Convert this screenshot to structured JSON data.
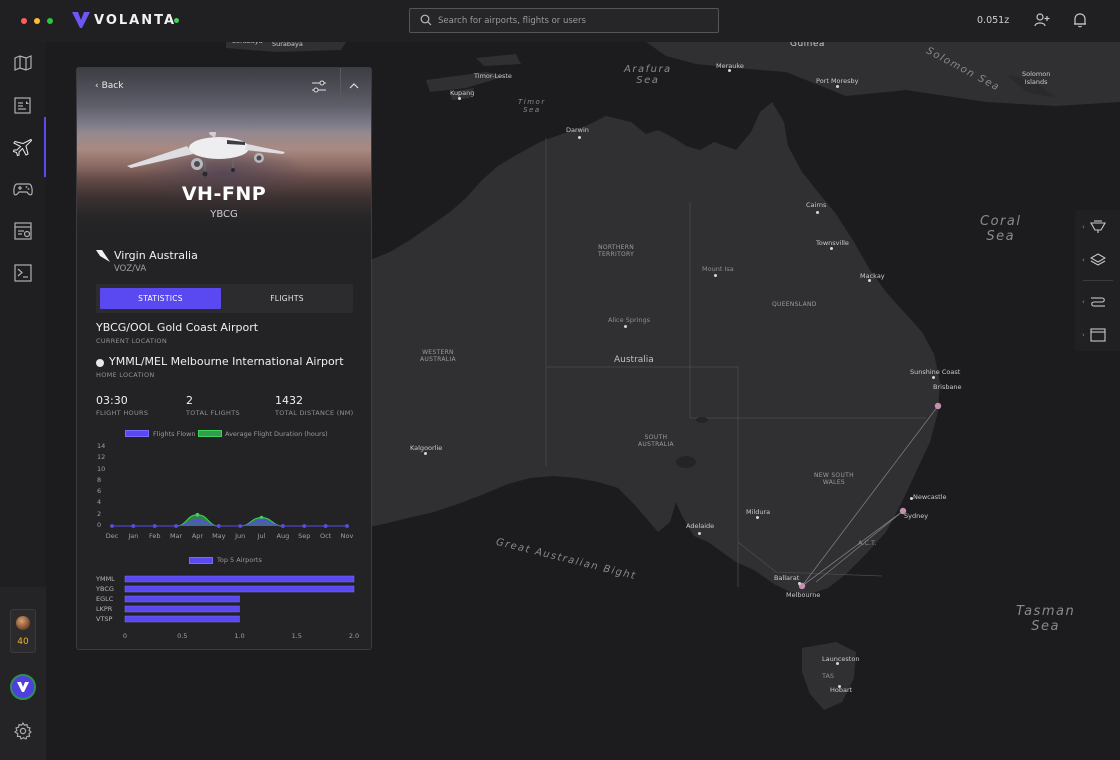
{
  "app": {
    "name": "VOLANTA",
    "zulu_time": "0.051z"
  },
  "search": {
    "placeholder": "Search for airports, flights or users"
  },
  "sidebar": {
    "items": [
      {
        "name": "map-icon"
      },
      {
        "name": "flight-plan-icon"
      },
      {
        "name": "aircraft-icon"
      },
      {
        "name": "gamepad-icon"
      },
      {
        "name": "logbook-icon"
      },
      {
        "name": "terminal-icon"
      }
    ],
    "user": {
      "points": "40"
    }
  },
  "map": {
    "regions": [
      "NORTHERN\nTERRITORY",
      "QUEENSLAND",
      "WESTERN\nAUSTRALIA",
      "SOUTH\nAUSTRALIA",
      "NEW SOUTH\nWALES",
      "Australia"
    ],
    "seas": [
      "Arafura\nSea",
      "Timor\nSea",
      "Solomon Sea",
      "Coral\nSea",
      "Great Australian Bight",
      "Tasman\nSea",
      "Guinea"
    ],
    "cities": [
      "Sorabaya",
      "Surabaya",
      "Timor-Leste",
      "Kupang",
      "Merauke",
      "Port Moresby",
      "Solomon\nIslands",
      "Darwin",
      "Cairns",
      "Townsville",
      "Mackay",
      "Mount Isa",
      "Alice Springs",
      "Sunshine Coast",
      "Brisbane",
      "Kalgoorlie",
      "Newcastle",
      "Sydney",
      "Adelaide",
      "Mildura",
      "A.C.T.",
      "Ballarat",
      "Melbourne",
      "Launceston",
      "TAS",
      "Hobart"
    ]
  },
  "right_tools": [
    {
      "name": "weather-icon"
    },
    {
      "name": "layers-icon"
    },
    {
      "name": "route-icon"
    },
    {
      "name": "window-icon"
    }
  ],
  "panel": {
    "back_label": "Back",
    "registration": "VH-FNP",
    "icao": "YBCG",
    "airline": "Virgin Australia",
    "airline_code": "VOZ/VA",
    "tabs": [
      "STATISTICS",
      "FLIGHTS"
    ],
    "current_location": "YBCG/OOL Gold Coast Airport",
    "current_location_label": "CURRENT LOCATION",
    "home_location": "YMML/MEL Melbourne International Airport",
    "home_location_label": "HOME LOCATION",
    "stats": [
      {
        "value": "03:30",
        "label": "FLIGHT HOURS"
      },
      {
        "value": "2",
        "label": "TOTAL FLIGHTS"
      },
      {
        "value": "1432",
        "label": "TOTAL DISTANCE (NM)"
      }
    ]
  },
  "colors": {
    "accent": "#5a48f0",
    "green": "#3fd35d",
    "map_land": "#303033",
    "map_water": "#1c1c1e"
  },
  "chart_data": [
    {
      "type": "area",
      "categories": [
        "Dec",
        "Jan",
        "Feb",
        "Mar",
        "Apr",
        "May",
        "Jun",
        "Jul",
        "Aug",
        "Sep",
        "Oct",
        "Nov"
      ],
      "series": [
        {
          "name": "Flights Flown",
          "values": [
            0,
            0,
            0,
            0,
            1,
            0,
            0,
            1,
            0,
            0,
            0,
            0
          ],
          "color": "#5a48f0"
        },
        {
          "name": "Average Flight Duration (hours)",
          "values": [
            0,
            0,
            0,
            0,
            2,
            0,
            0,
            1.5,
            0,
            0,
            0,
            0
          ],
          "color": "#3fd35d"
        }
      ],
      "yticks": [
        0,
        2,
        4,
        6,
        8,
        10,
        12,
        14
      ],
      "ylim": [
        0,
        14
      ],
      "legend": "top"
    },
    {
      "type": "bar",
      "orientation": "horizontal",
      "title": "Top 5 Airports",
      "categories": [
        "YMML",
        "YBCG",
        "EGLC",
        "LKPR",
        "VTSP"
      ],
      "values": [
        2,
        2,
        1,
        1,
        1
      ],
      "xticks": [
        "0",
        "0.5",
        "1.0",
        "1.5",
        "2.0"
      ],
      "xlim": [
        0,
        2
      ],
      "color": "#5a48f0"
    }
  ]
}
